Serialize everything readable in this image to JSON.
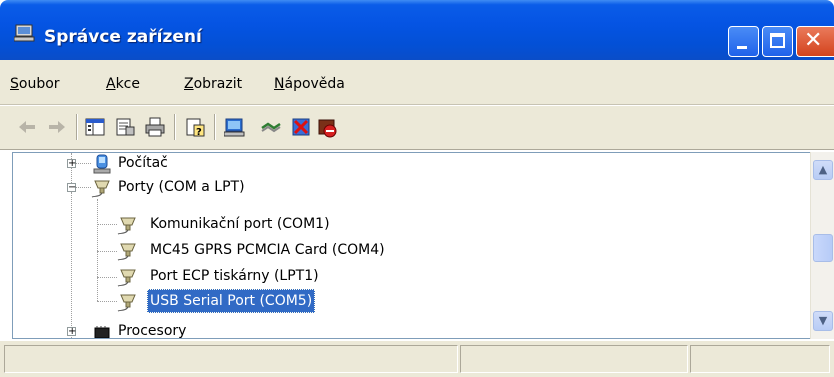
{
  "window": {
    "title": "Správce zařízení",
    "icon": "computer-monitor-icon"
  },
  "titlebar_buttons": {
    "minimize": "minimize-icon",
    "maximize": "maximize-icon",
    "close": "close-icon"
  },
  "menu": {
    "items": [
      {
        "label": "Soubor",
        "accel": "S"
      },
      {
        "label": "Akce",
        "accel": "A"
      },
      {
        "label": "Zobrazit",
        "accel": "Z"
      },
      {
        "label": "Nápověda",
        "accel": "N"
      }
    ]
  },
  "toolbar": {
    "icons": [
      "back-arrow-icon",
      "forward-arrow-icon",
      "show-hide-tree-icon",
      "properties-icon",
      "print-icon",
      "help-icon",
      "scan-hardware-icon",
      "update-driver-icon",
      "uninstall-icon",
      "disable-device-icon"
    ]
  },
  "tree": {
    "items": [
      {
        "label": "Počítač",
        "icon": "computer-icon",
        "expander": "+"
      },
      {
        "label": "Porty (COM a LPT)",
        "icon": "port-connector-icon",
        "expander": "−"
      },
      {
        "label": "Komunikační port (COM1)",
        "icon": "port-connector-icon"
      },
      {
        "label": "MC45 GPRS PCMCIA Card (COM4)",
        "icon": "port-connector-icon"
      },
      {
        "label": "Port ECP tiskárny (LPT1)",
        "icon": "port-connector-icon"
      },
      {
        "label": "USB Serial Port (COM5)",
        "icon": "port-connector-icon",
        "selected": true
      },
      {
        "label": "Procesory",
        "icon": "processor-icon",
        "expander": "+"
      }
    ]
  },
  "colors": {
    "titlebar": "#0554e3",
    "selection": "#316ac5",
    "chrome": "#ece9d8"
  }
}
